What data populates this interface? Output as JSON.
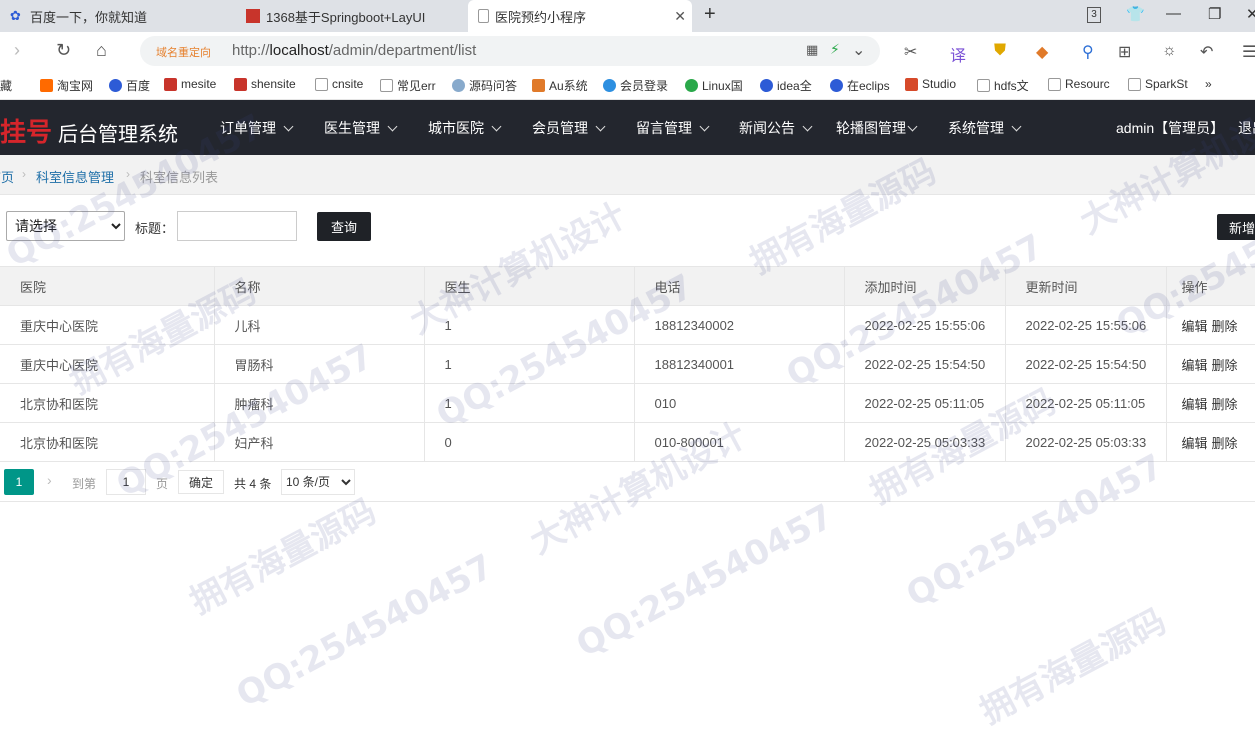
{
  "browser": {
    "tabs": [
      {
        "title": "百度一下，你就知道",
        "active": false
      },
      {
        "title": "1368基于Springboot+LayUI",
        "active": false
      },
      {
        "title": "医院预约小程序",
        "active": true
      }
    ],
    "new_tab": "+",
    "tab_count": "3",
    "redirect_tag": "域名重定向",
    "url_prefix": "http://",
    "url_host": "localhost",
    "url_path": "/admin/department/list",
    "bookmarks": [
      "藏",
      "淘宝网",
      "百度",
      "mesite",
      "shensite",
      "cnsite",
      "常见err",
      "源码问答",
      "Au系统",
      "会员登录",
      "Linux国",
      "idea全",
      "在eclips",
      "Studio",
      "hdfs文",
      "Resourc",
      "SparkSt",
      "»"
    ]
  },
  "header": {
    "logo_brand": "就挂号",
    "logo_title": "后台管理系统",
    "menu": [
      "订单管理",
      "医生管理",
      "城市医院",
      "会员管理",
      "留言管理",
      "新闻公告",
      "轮播图管理",
      "系统管理"
    ],
    "user": "admin【管理员】",
    "logout": "退出"
  },
  "breadcrumb": [
    "首页",
    "科室信息管理",
    "科室信息列表"
  ],
  "search": {
    "select_value": "请选择",
    "title_label": "标题：",
    "title_value": "",
    "query_label": "查询",
    "add_label": "新增"
  },
  "table": {
    "columns": [
      "医院",
      "名称",
      "医生",
      "电话",
      "添加时间",
      "更新时间",
      "操作"
    ],
    "rows": [
      {
        "hospital": "重庆中心医院",
        "name": "儿科",
        "doctors": "1",
        "phone": "18812340002",
        "created": "2022-02-25 15:55:06",
        "updated": "2022-02-25 15:55:06"
      },
      {
        "hospital": "重庆中心医院",
        "name": "胃肠科",
        "doctors": "1",
        "phone": "18812340001",
        "created": "2022-02-25 15:54:50",
        "updated": "2022-02-25 15:54:50"
      },
      {
        "hospital": "北京协和医院",
        "name": "肿瘤科",
        "doctors": "1",
        "phone": "010",
        "created": "2022-02-25 05:11:05",
        "updated": "2022-02-25 05:11:05"
      },
      {
        "hospital": "北京协和医院",
        "name": "妇产科",
        "doctors": "0",
        "phone": "010-800001",
        "created": "2022-02-25 05:03:33",
        "updated": "2022-02-25 05:03:33"
      }
    ],
    "edit_label": "编辑",
    "delete_label": "删除"
  },
  "pagination": {
    "current_page": "1",
    "goto_label": "到第",
    "goto_value": "1",
    "page_unit": "页",
    "confirm_label": "确定",
    "total_label": "共 4 条",
    "page_size": "10 条/页"
  },
  "watermark": {
    "texts": [
      "QQ:254540457",
      "拥有海量源码",
      "大神计算机设计"
    ]
  },
  "colors": {
    "header_bg": "#23262e",
    "brand_red": "#d6252b",
    "page_active": "#009688",
    "button_dark": "#1f2227"
  }
}
